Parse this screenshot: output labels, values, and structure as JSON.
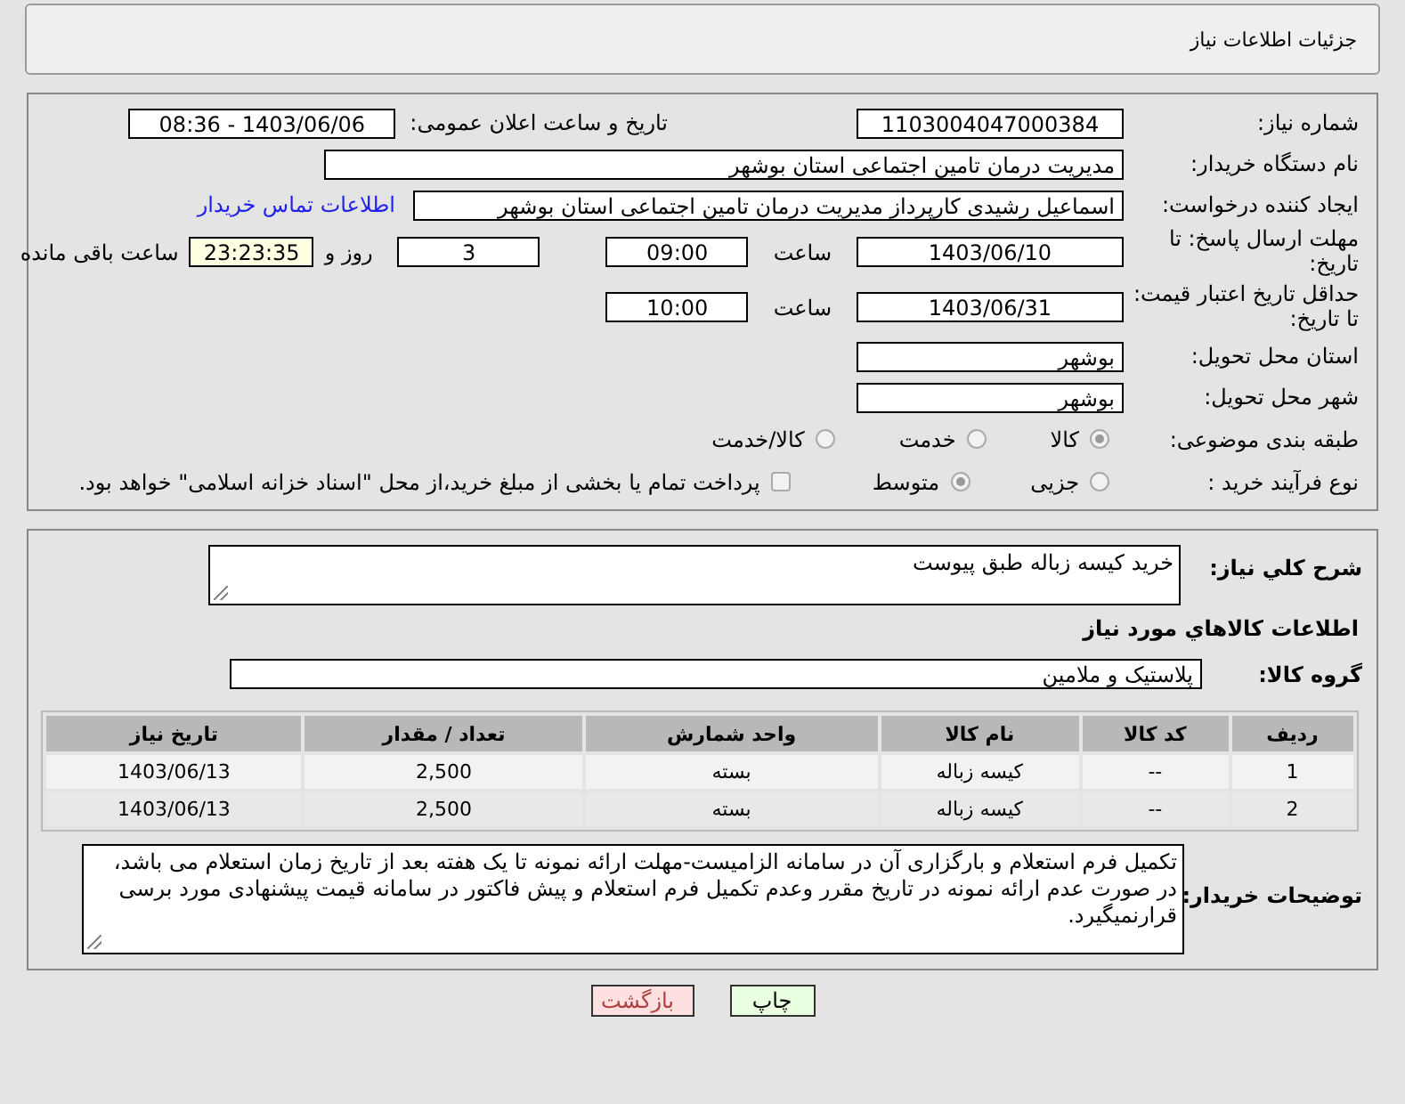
{
  "header": {
    "title": "جزئیات اطلاعات نیاز"
  },
  "need_number": {
    "label": "شماره نیاز:",
    "value": "1103004047000384"
  },
  "announce_datetime": {
    "label": "تاریخ و ساعت اعلان عمومی:",
    "value": "1403/06/06 - 08:36"
  },
  "buyer_org": {
    "label": "نام دستگاه خریدار:",
    "value": "مدیریت درمان تامین اجتماعی استان بوشهر"
  },
  "requester": {
    "label": "ایجاد کننده درخواست:",
    "value": "اسماعیل رشیدی کارپرداز مدیریت درمان تامین اجتماعی استان بوشهر",
    "link": "اطلاعات تماس خریدار"
  },
  "reply_deadline": {
    "label": "مهلت ارسال پاسخ: تا تاریخ:",
    "date": "1403/06/10",
    "time_label": "ساعت",
    "time": "09:00",
    "days": "3",
    "days_label": "روز و",
    "remaining": "23:23:35",
    "remaining_label": "ساعت باقی مانده"
  },
  "price_validity": {
    "label": "حداقل تاریخ اعتبار قیمت: تا تاریخ:",
    "date": "1403/06/31",
    "time_label": "ساعت",
    "time": "10:00"
  },
  "province": {
    "label": "استان محل تحویل:",
    "value": "بوشهر"
  },
  "city": {
    "label": "شهر محل تحویل:",
    "value": "بوشهر"
  },
  "category": {
    "label": "طبقه بندی موضوعی:",
    "options": [
      {
        "label": "کالا",
        "selected": true
      },
      {
        "label": "خدمت",
        "selected": false
      },
      {
        "label": "کالا/خدمت",
        "selected": false
      }
    ]
  },
  "process": {
    "label": "نوع فرآیند خرید :",
    "options": [
      {
        "label": "جزیی",
        "selected": false
      },
      {
        "label": "متوسط",
        "selected": true
      }
    ],
    "payment_note": {
      "label": "پرداخت تمام یا بخشی از مبلغ خرید،از محل \"اسناد خزانه اسلامی\" خواهد بود.",
      "checked": false
    }
  },
  "summary": {
    "label": "شرح کلي نياز:",
    "value": "خرید کیسه زباله طبق پیوست"
  },
  "goods_heading": "اطلاعات کالاهاي مورد نياز",
  "goods_group": {
    "label": "گروه کالا:",
    "value": "پلاستیک و ملامین"
  },
  "table": {
    "columns": [
      "ردیف",
      "کد کالا",
      "نام کالا",
      "واحد شمارش",
      "تعداد / مقدار",
      "تاریخ نیاز"
    ],
    "rows": [
      [
        "1",
        "--",
        "کیسه زباله",
        "بسته",
        "2,500",
        "1403/06/13"
      ],
      [
        "2",
        "--",
        "کیسه زباله",
        "بسته",
        "2,500",
        "1403/06/13"
      ]
    ]
  },
  "buyer_notes": {
    "label": "توضیحات خریدار:",
    "value": "تکمیل فرم استعلام و بارگزاری آن در سامانه الزامیست-مهلت ارائه نمونه تا یک هفته بعد از تاریخ زمان استعلام می باشد، در صورت عدم ارائه نمونه در تاریخ مقرر وعدم تکمیل فرم استعلام و پیش فاکتور در سامانه  قیمت پیشنهادی مورد برسی قرارنمیگیرد."
  },
  "buttons": [
    {
      "label": "چاپ",
      "kind": "print"
    },
    {
      "label": "بازگشت",
      "kind": "back"
    }
  ]
}
